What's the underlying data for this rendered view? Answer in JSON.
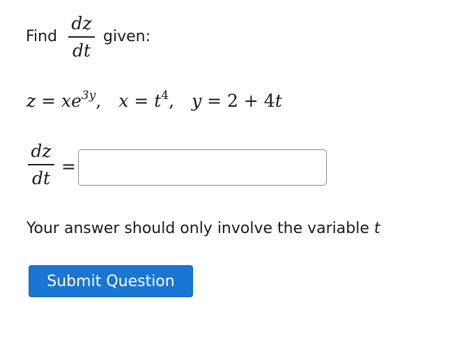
{
  "prompt": {
    "find_label": "Find",
    "derivative_num": "dz",
    "derivative_den": "dt",
    "given_label": "given:"
  },
  "equation": {
    "z_var": "z",
    "eq1": " = ",
    "x_var": "x",
    "e_const": "e",
    "exp_3y": "3y",
    "sep1": ",",
    "x_var2": "x",
    "eq2": " = ",
    "t_var": "t",
    "exp_4": "4",
    "sep2": ",",
    "y_var": "y",
    "eq3": " = 2 + 4",
    "t_var2": "t"
  },
  "answer_row": {
    "derivative_num": "dz",
    "derivative_den": "dt",
    "equals": "=",
    "input_value": "",
    "input_placeholder": ""
  },
  "hint": {
    "text": "Your answer should only involve the variable ",
    "variable": "t"
  },
  "submit": {
    "label": "Submit Question"
  },
  "colors": {
    "button_bg": "#1976d2",
    "button_text": "#ffffff",
    "input_border": "#8a8a8a",
    "text": "#1a1a1a"
  }
}
